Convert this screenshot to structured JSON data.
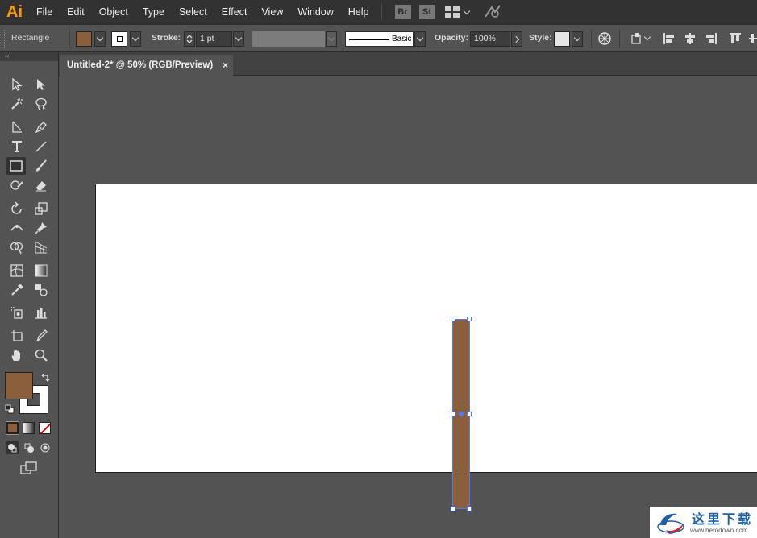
{
  "app": {
    "logo": "Ai",
    "menu": [
      "File",
      "Edit",
      "Object",
      "Type",
      "Select",
      "Effect",
      "View",
      "Window",
      "Help"
    ],
    "bridge_buttons": [
      "Br",
      "St"
    ]
  },
  "control_bar": {
    "tool_name": "Rectangle",
    "fill_color": "#8b5e3c",
    "stroke_label": "Stroke:",
    "stroke_weight": "1 pt",
    "brush_label": "Basic",
    "opacity_label": "Opacity:",
    "opacity_value": "100%",
    "style_label": "Style:"
  },
  "document": {
    "tab_title": "Untitled-2* @ 50% (RGB/Preview)",
    "tab_close": "×"
  },
  "toolbar": {
    "collapse_glyph": "‹‹",
    "fill_color": "#8b5e3c",
    "stroke_color": "#ffffff"
  },
  "watermark": {
    "chinese_text": "这里下载",
    "url": "www.herodown.com"
  }
}
